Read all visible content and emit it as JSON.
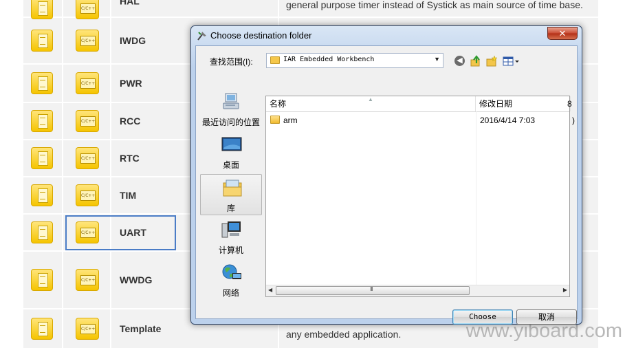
{
  "background": {
    "rows": [
      {
        "name": "HAL",
        "desc": "general purpose timer instead of Systick as main source of time base."
      },
      {
        "name": "IWDG",
        "desc": ""
      },
      {
        "name": "PWR",
        "desc": ""
      },
      {
        "name": "RCC",
        "desc": ""
      },
      {
        "name": "RTC",
        "desc": ""
      },
      {
        "name": "TIM",
        "desc": ""
      },
      {
        "name": "UART",
        "desc": ""
      },
      {
        "name": "WWDG",
        "desc": ""
      },
      {
        "name": "Template",
        "desc": "any embedded application."
      }
    ],
    "chip_label": "C/C++",
    "highlight_color": "#4a7cc6"
  },
  "watermark": "www.yiboard.com",
  "dialog": {
    "title": "Choose destination folder",
    "close_label": "✕",
    "look_in_label": "查找范围(I):",
    "look_in_value": "IAR Embedded Workbench",
    "places": [
      {
        "label": "最近访问的位置",
        "icon": "recent-places-icon"
      },
      {
        "label": "桌面",
        "icon": "desktop-icon"
      },
      {
        "label": "库",
        "icon": "libraries-icon"
      },
      {
        "label": "计算机",
        "icon": "computer-icon"
      },
      {
        "label": "网络",
        "icon": "network-icon"
      }
    ],
    "columns": {
      "name": "名称",
      "date": "修改日期",
      "extra": "8"
    },
    "files": [
      {
        "name": "arm",
        "date": "2016/4/14 7:03",
        "extra": ")"
      }
    ],
    "scroll_grip": "III",
    "buttons": {
      "choose": "Choose",
      "cancel": "取消"
    }
  }
}
